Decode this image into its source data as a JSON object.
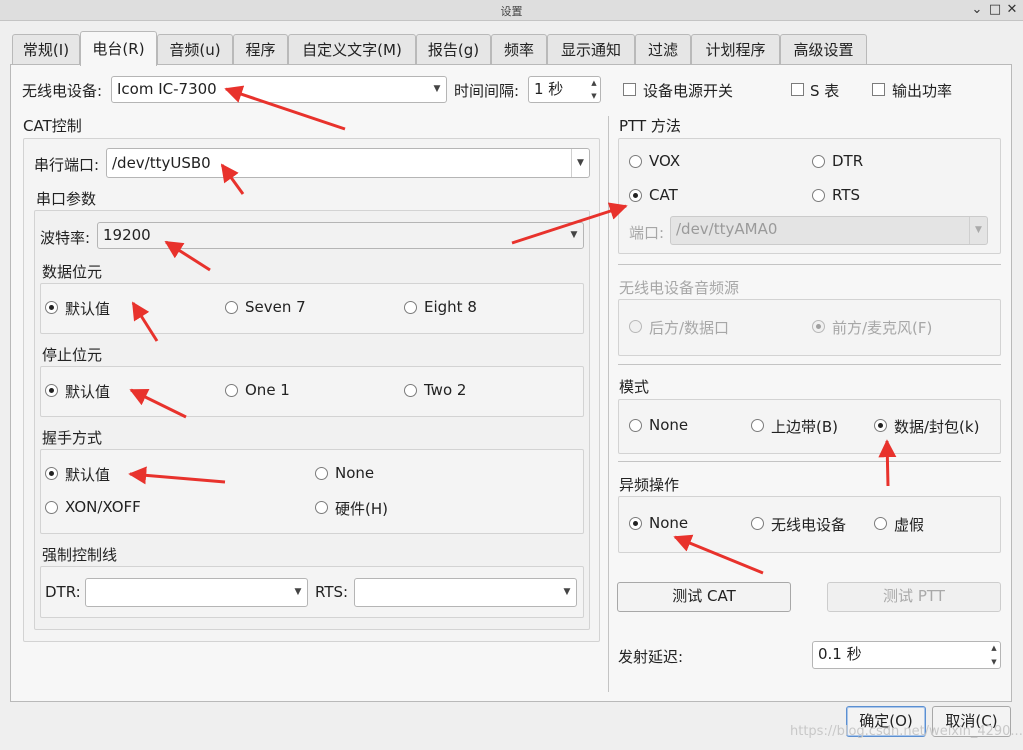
{
  "window": {
    "title": "设置"
  },
  "tabs": [
    "常规(I)",
    "电台(R)",
    "音频(u)",
    "程序",
    "自定义文字(M)",
    "报告(g)",
    "频率",
    "显示通知",
    "过滤",
    "计划程序",
    "高级设置"
  ],
  "radio_device": {
    "label": "无线电设备:",
    "value": "Icom IC-7300"
  },
  "time_interval": {
    "label": "时间间隔:",
    "value": "1 秒"
  },
  "top_checks": {
    "power": "设备电源开关",
    "s_meter": "S 表",
    "output_power": "输出功率"
  },
  "cat": {
    "title": "CAT控制",
    "serial_port_label": "串行端口:",
    "serial_port_value": "/dev/ttyUSB0",
    "params_title": "串口参数",
    "baud_label": "波特率:",
    "baud_value": "19200",
    "data_bits": {
      "title": "数据位元",
      "options": [
        "默认值",
        "Seven 7",
        "Eight 8"
      ]
    },
    "stop_bits": {
      "title": "停止位元",
      "options": [
        "默认值",
        "One 1",
        "Two 2"
      ]
    },
    "handshake": {
      "title": "握手方式",
      "options": [
        "默认值",
        "None",
        "XON/XOFF",
        "硬件(H)"
      ]
    },
    "force_lines": {
      "title": "强制控制线",
      "dtr_label": "DTR:",
      "rts_label": "RTS:"
    }
  },
  "ptt": {
    "title": "PTT 方法",
    "options": [
      "VOX",
      "DTR",
      "CAT",
      "RTS"
    ],
    "port_label": "端口:",
    "port_value": "/dev/ttyAMA0"
  },
  "audio_source": {
    "title": "无线电设备音频源",
    "options": [
      "后方/数据口",
      "前方/麦克风(F)"
    ]
  },
  "mode": {
    "title": "模式",
    "options": [
      "None",
      "上边带(B)",
      "数据/封包(k)"
    ]
  },
  "split": {
    "title": "异频操作",
    "options": [
      "None",
      "无线电设备",
      "虚假"
    ]
  },
  "buttons": {
    "test_cat": "测试 CAT",
    "test_ptt": "测试 PTT",
    "ok": "确定(O)",
    "cancel": "取消(C)"
  },
  "tx_delay": {
    "label": "发射延迟:",
    "value": "0.1 秒"
  },
  "watermark": "https://blog.csdn.net/weixin_4290..."
}
